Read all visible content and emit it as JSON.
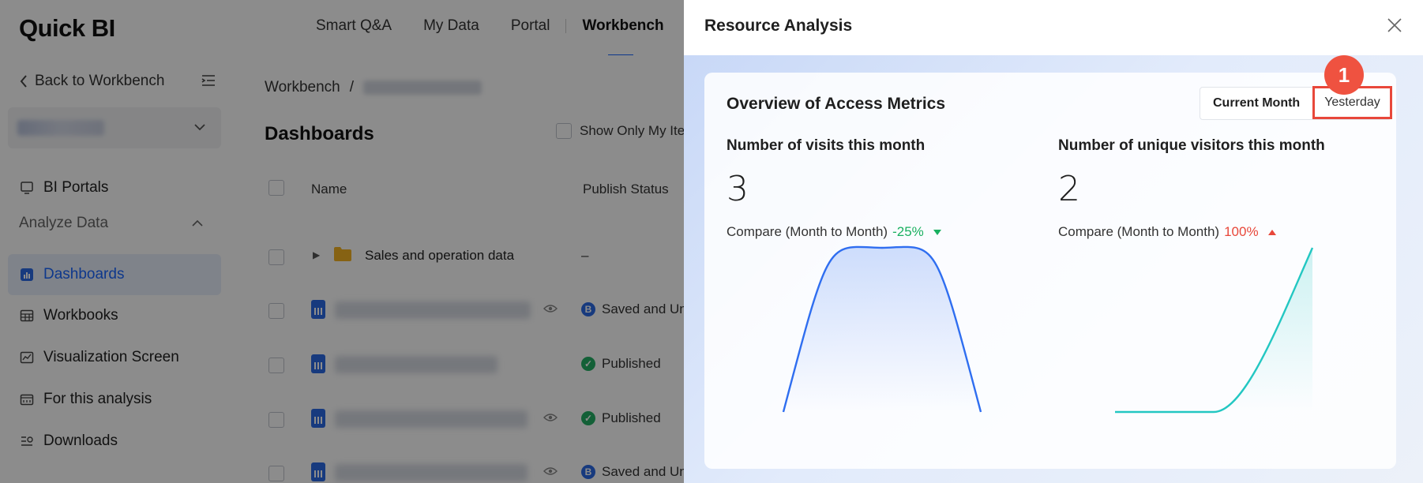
{
  "app": {
    "logo": "Quick BI",
    "nav": [
      {
        "label": "Smart Q&A"
      },
      {
        "label": "My Data"
      },
      {
        "label": "Portal"
      },
      {
        "label": "Workbench",
        "active": true
      }
    ]
  },
  "sidebar": {
    "back_label": "Back to Workbench",
    "items": [
      {
        "label": "BI Portals",
        "icon": "monitor-icon"
      },
      {
        "label": "Dashboards",
        "icon": "bar-chart-icon",
        "active": true
      },
      {
        "label": "Workbooks",
        "icon": "table-icon"
      },
      {
        "label": "Visualization Screen",
        "icon": "screen-chart-icon"
      },
      {
        "label": "For this analysis",
        "icon": "analysis-icon"
      },
      {
        "label": "Downloads",
        "icon": "download-list-icon"
      }
    ],
    "group_label": "Analyze Data"
  },
  "main": {
    "breadcrumb_root": "Workbench",
    "breadcrumb_sep": "/",
    "title": "Dashboards",
    "show_only_mine": "Show Only My Ite",
    "columns": {
      "name": "Name",
      "status": "Publish Status"
    },
    "rows": [
      {
        "name": "Sales and operation data",
        "status": "–",
        "type": "folder"
      },
      {
        "status": "Saved and Un",
        "status_kind": "saved",
        "eye": true
      },
      {
        "status": "Published",
        "status_kind": "published",
        "eye": false
      },
      {
        "status": "Published",
        "status_kind": "published",
        "eye": true
      },
      {
        "status": "Saved and Un",
        "status_kind": "saved",
        "eye": true
      }
    ]
  },
  "drawer": {
    "title": "Resource Analysis",
    "card_title": "Overview of Access Metrics",
    "segments": {
      "current": "Current Month",
      "yesterday": "Yesterday"
    },
    "callout_number": "1",
    "metrics": [
      {
        "label": "Number of visits this month",
        "value": "3",
        "compare_label": "Compare (Month to Month)",
        "change": "-25%",
        "direction": "down"
      },
      {
        "label": "Number of unique visitors this month",
        "value": "2",
        "compare_label": "Compare (Month to Month)",
        "change": "100%",
        "direction": "up"
      }
    ]
  },
  "colors": {
    "accent": "#1a66ff",
    "up": "#e8473a",
    "down": "#19b060",
    "visits_line": "#2f6ef0",
    "visitors_line": "#23c7c2"
  },
  "chart_data": [
    {
      "type": "area",
      "series": [
        {
          "values": [
            0,
            3,
            0
          ]
        }
      ]
    },
    {
      "type": "area",
      "series": [
        {
          "values": [
            0,
            0,
            2
          ]
        }
      ]
    }
  ]
}
